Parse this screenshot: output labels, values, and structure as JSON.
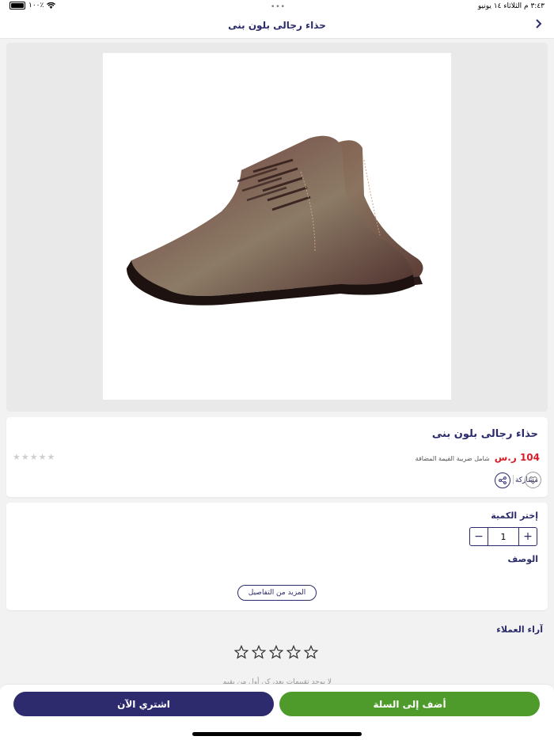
{
  "status_bar": {
    "time": "٣:٤٣ م",
    "date": "الثلاثاء ١٤ يونيو",
    "battery": "١٠٠٪"
  },
  "nav": {
    "title": "حذاء رجالى بلون بنى",
    "back_icon": "chevron-right-icon"
  },
  "product": {
    "title": "حذاء رجالى بلون بنى",
    "price": "104 ر.س",
    "vat_note": "شامل ضريبة القيمة المضافة",
    "rating_stars": "★★★★★",
    "share_label": "مشاركة"
  },
  "quantity": {
    "label": "إختر الكمية",
    "value": "1",
    "plus": "+",
    "minus": "−"
  },
  "description": {
    "label": "الوصف",
    "more_button": "المزيد من التفاصيل"
  },
  "reviews": {
    "title": "آراء العملاء",
    "empty_text": "لا يوجد تقييمات بعد، كن أول من يقيم"
  },
  "footer": {
    "buy_now": "اشتري الآن",
    "add_to_cart": "أضف إلى السلة"
  },
  "colors": {
    "primary": "#2d2a6e",
    "accent": "#4e9a2a",
    "price": "#d91e2a"
  }
}
